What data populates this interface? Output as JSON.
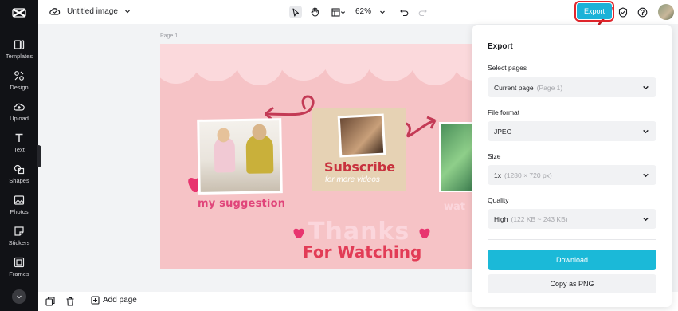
{
  "app": {
    "document_title": "Untitled image",
    "zoom_level": "62%"
  },
  "sidebar": {
    "items": [
      {
        "label": "Templates",
        "icon": "templates-icon"
      },
      {
        "label": "Design",
        "icon": "design-icon"
      },
      {
        "label": "Upload",
        "icon": "upload-icon"
      },
      {
        "label": "Text",
        "icon": "text-icon"
      },
      {
        "label": "Shapes",
        "icon": "shapes-icon"
      },
      {
        "label": "Photos",
        "icon": "photos-icon"
      },
      {
        "label": "Stickers",
        "icon": "stickers-icon"
      },
      {
        "label": "Frames",
        "icon": "frames-icon"
      }
    ]
  },
  "toolbar": {
    "export_label": "Export"
  },
  "canvas": {
    "page_label": "Page 1",
    "texts": {
      "suggestion": "my suggestion",
      "subscribe": "Subscribe",
      "for_more": "for more videos",
      "thanks": "Thanks",
      "for_watching": "For Watching",
      "partial": "wat"
    }
  },
  "bottombar": {
    "add_page_label": "Add page"
  },
  "export_panel": {
    "title": "Export",
    "select_pages_label": "Select pages",
    "select_pages_value": "Current page",
    "select_pages_hint": "(Page 1)",
    "file_format_label": "File format",
    "file_format_value": "JPEG",
    "size_label": "Size",
    "size_value": "1x",
    "size_hint": "(1280 × 720 px)",
    "quality_label": "Quality",
    "quality_value": "High",
    "quality_hint": "(122 KB ~ 243 KB)",
    "download_label": "Download",
    "copy_label": "Copy as PNG"
  },
  "colors": {
    "accent": "#1bb2d8",
    "annotation_red": "#e0262c",
    "rail_bg": "#111216",
    "canvas_pink": "#f6c3c6"
  }
}
